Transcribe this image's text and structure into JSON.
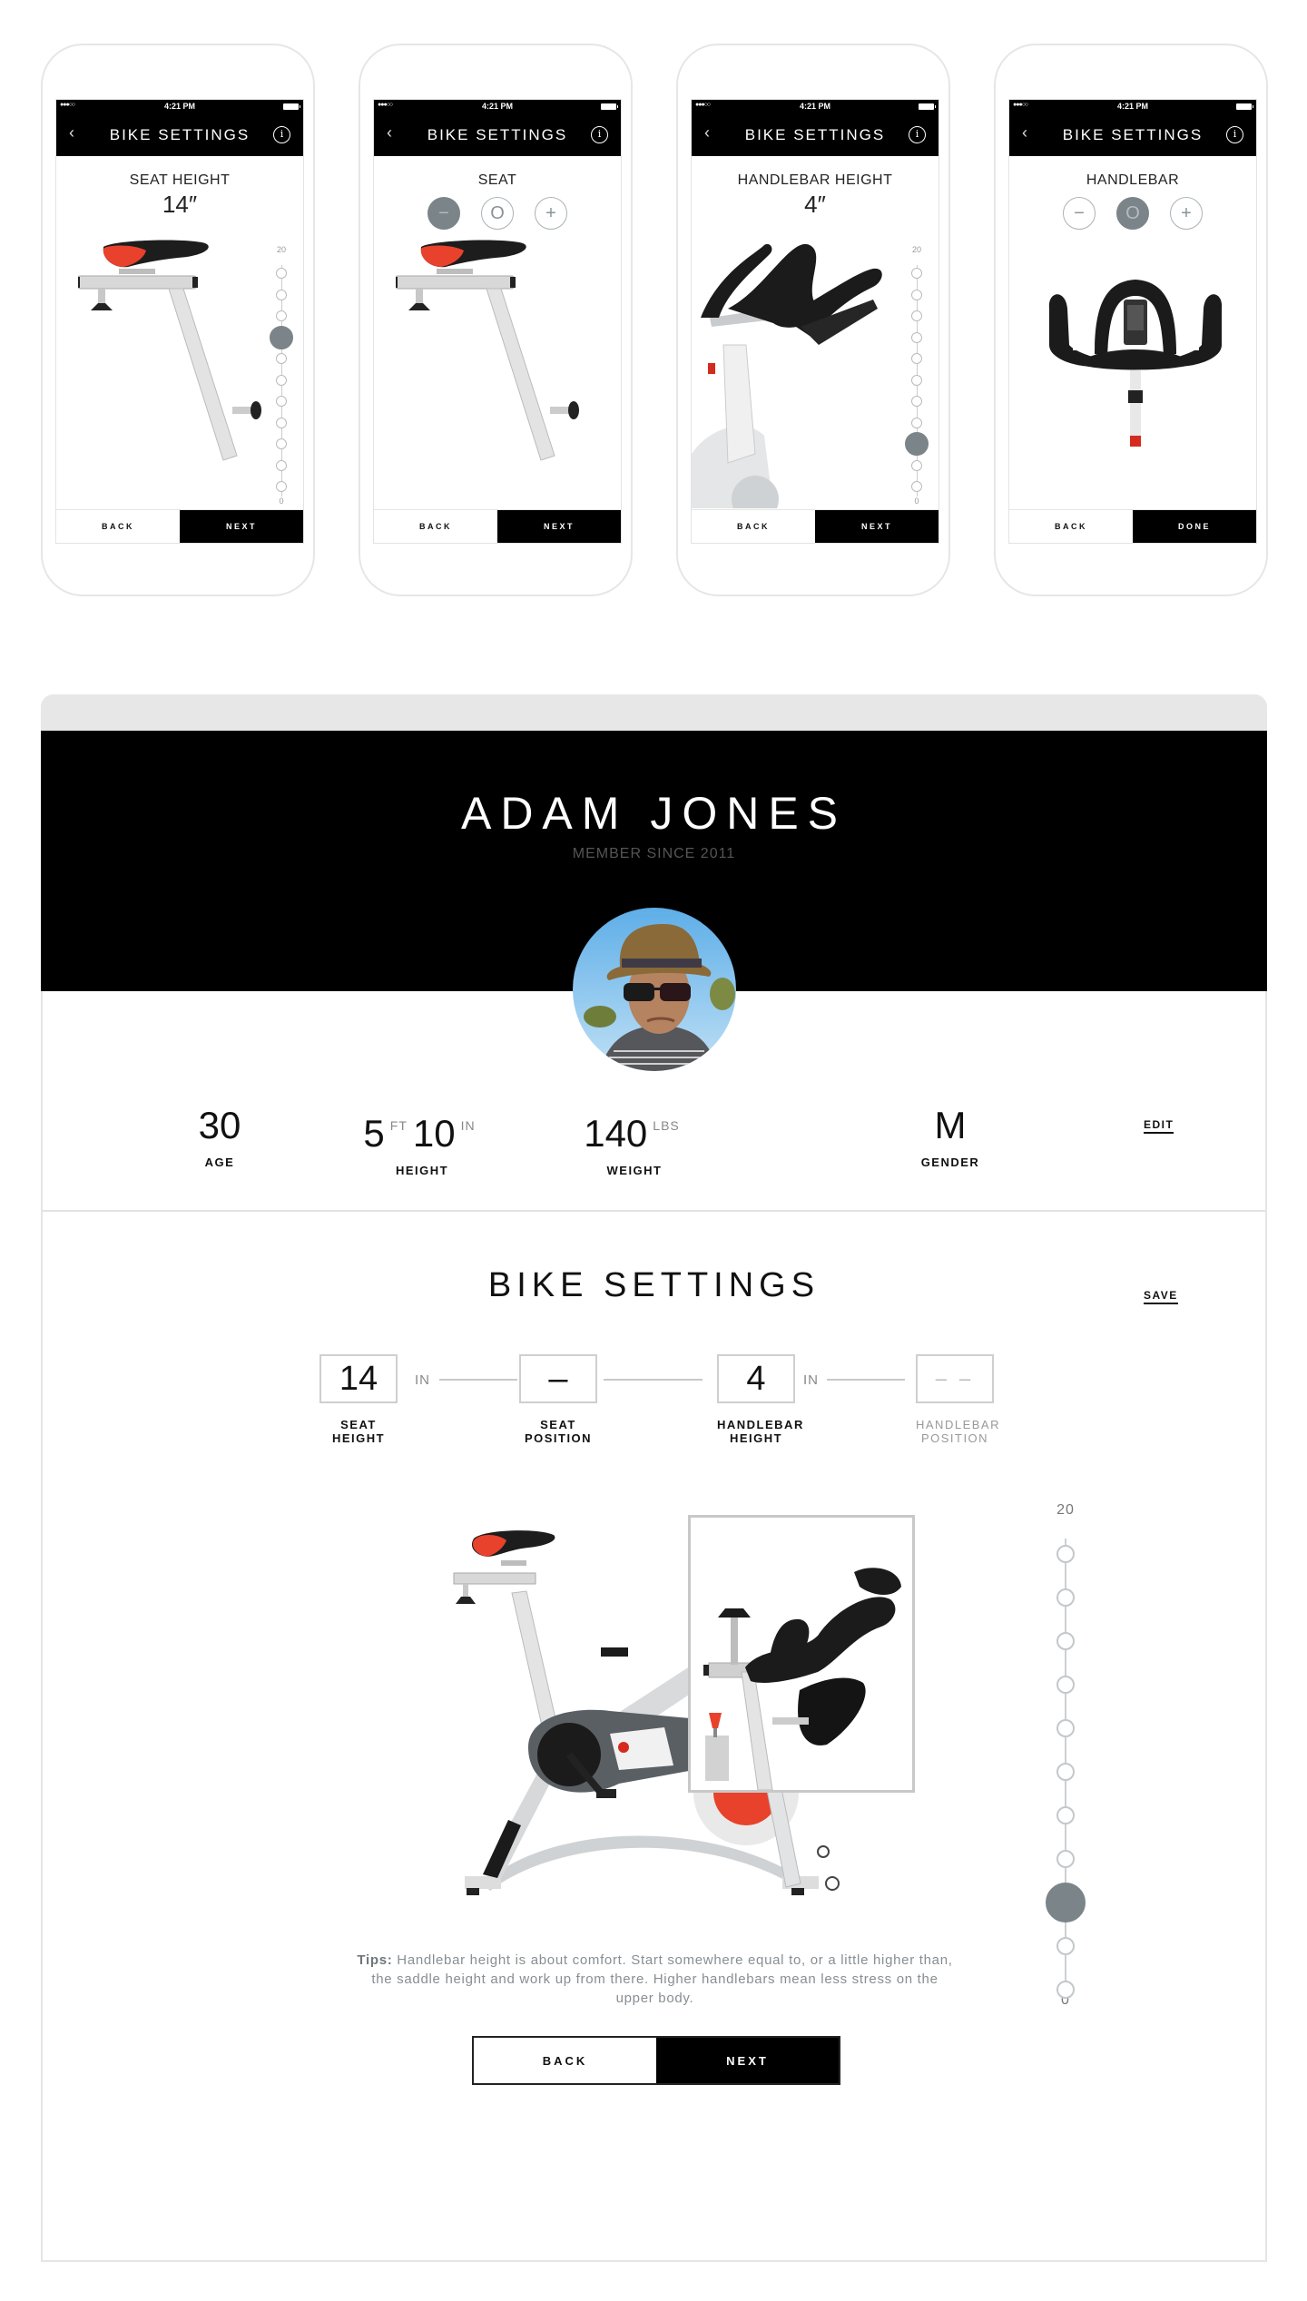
{
  "phones": [
    {
      "status": {
        "signal": "●●●○○",
        "time": "4:21 PM"
      },
      "nav": {
        "back": "‹",
        "title": "BIKE SETTINGS",
        "info": "i"
      },
      "label": "SEAT HEIGHT",
      "value": "14″",
      "slider": {
        "max_label": "20",
        "min_label": "0",
        "max": 20,
        "min": 0,
        "value": 14
      },
      "buttons": {
        "back": "BACK",
        "next": "NEXT"
      }
    },
    {
      "status": {
        "signal": "●●●○○",
        "time": "4:21 PM"
      },
      "nav": {
        "back": "‹",
        "title": "BIKE SETTINGS",
        "info": "i"
      },
      "label": "SEAT",
      "steppers": {
        "minus": "−",
        "zero": "O",
        "plus": "+",
        "active": "minus"
      },
      "buttons": {
        "back": "BACK",
        "next": "NEXT"
      }
    },
    {
      "status": {
        "signal": "●●●○○",
        "time": "4:21 PM"
      },
      "nav": {
        "back": "‹",
        "title": "BIKE SETTINGS",
        "info": "i"
      },
      "label": "HANDLEBAR HEIGHT",
      "value": "4″",
      "slider": {
        "max_label": "20",
        "min_label": "0",
        "max": 20,
        "min": 0,
        "value": 4
      },
      "buttons": {
        "back": "BACK",
        "next": "NEXT"
      }
    },
    {
      "status": {
        "signal": "●●●○○",
        "time": "4:21 PM"
      },
      "nav": {
        "back": "‹",
        "title": "BIKE SETTINGS",
        "info": "i"
      },
      "label": "HANDLEBAR",
      "steppers": {
        "minus": "−",
        "zero": "O",
        "plus": "+",
        "active": "zero"
      },
      "buttons": {
        "back": "BACK",
        "next": "DONE"
      }
    }
  ],
  "profile": {
    "name": "ADAM JONES",
    "member_since": "MEMBER SINCE 2011",
    "stats": {
      "age": {
        "value": "30",
        "label": "AGE"
      },
      "height": {
        "feet": "5",
        "feet_unit": "FT",
        "inches": "10",
        "inches_unit": "IN",
        "label": "HEIGHT"
      },
      "weight": {
        "value": "140",
        "unit": "LBS",
        "label": "WEIGHT"
      },
      "gender": {
        "value": "M",
        "label": "GENDER"
      }
    },
    "edit_label": "EDIT"
  },
  "bike_settings": {
    "title": "BIKE SETTINGS",
    "save_label": "SAVE",
    "fields": [
      {
        "value": "14",
        "unit": "IN",
        "label_line1": "SEAT",
        "label_line2": "HEIGHT"
      },
      {
        "value": "–",
        "label_line1": "SEAT",
        "label_line2": "POSITION"
      },
      {
        "value": "4",
        "unit": "IN",
        "label_line1": "HANDLEBAR",
        "label_line2": "HEIGHT"
      },
      {
        "value": "– –",
        "label_line1": "HANDLEBAR",
        "label_line2": "POSITION",
        "disabled": true
      }
    ],
    "slider": {
      "max_label": "20",
      "min_label": "0",
      "max": 20,
      "min": 0,
      "step": 2,
      "value": 4
    },
    "tips_label": "Tips:",
    "tips_text": " Handlebar height is about comfort. Start somewhere equal to, or a little higher than, the saddle height and work up from there. Higher handlebars mean less stress on the upper body.",
    "back_label": "BACK",
    "next_label": "NEXT"
  },
  "colors": {
    "accent_grey": "#7b8489",
    "saddle_red": "#e8412c",
    "black": "#000000"
  }
}
